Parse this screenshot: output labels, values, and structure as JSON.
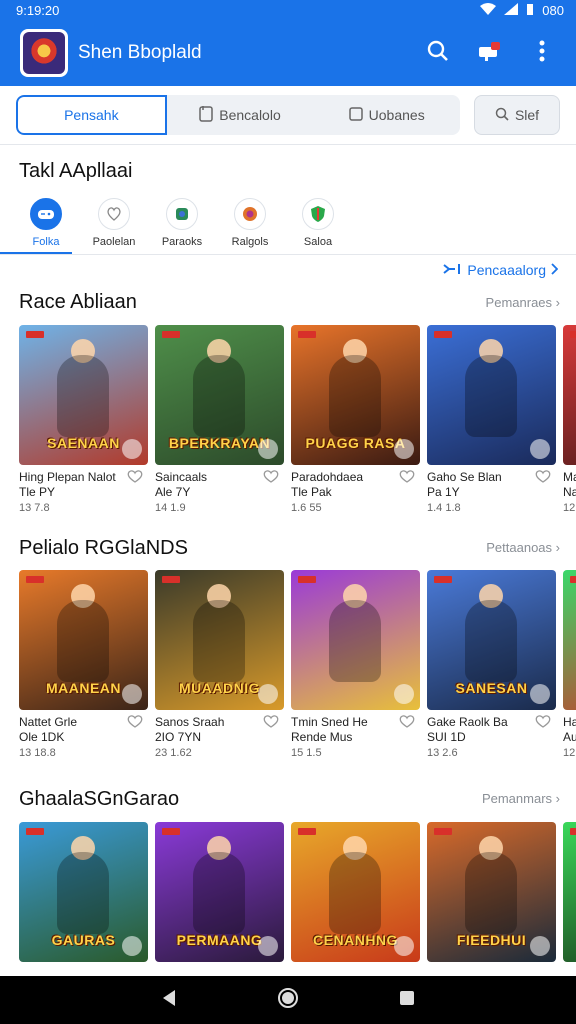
{
  "status_bar": {
    "time": "9:19:20",
    "battery": "080"
  },
  "app_bar": {
    "title": "Shen Bboplald"
  },
  "search_tabs": [
    {
      "label": "Pensahk",
      "icon": "none"
    },
    {
      "label": "Bencalolo",
      "icon": "doc-icon"
    },
    {
      "label": "Uobanes",
      "icon": "box-icon"
    }
  ],
  "filter": {
    "label": "Slef"
  },
  "categories_title": "Takl AApllaai",
  "categories": [
    {
      "label": "Folka",
      "icon": "game-controller-icon",
      "color": "#1a73e8"
    },
    {
      "label": "Paolelan",
      "icon": "heart-hands-icon",
      "color": "#9a9a9a"
    },
    {
      "label": "Paraoks",
      "icon": "puzzle-icon",
      "color": "#2a8a5a"
    },
    {
      "label": "Ralgols",
      "icon": "star-badge-icon",
      "color": "#e0732a"
    },
    {
      "label": "Saloa",
      "icon": "shield-icon",
      "color": "#2aa84a"
    }
  ],
  "recommend_link": "Pencaaalorg",
  "sections": [
    {
      "title": "Race Abliaan",
      "more": "Pemanraes",
      "cards": [
        {
          "l1": "Hing Plepan Nalot",
          "l2": "Tle PY",
          "l3": "13  7.8",
          "art_text": "SAENAAN",
          "c1": "#6fb3e8",
          "c2": "#b23a2a"
        },
        {
          "l1": "Saincaals",
          "l2": "Ale 7Y",
          "l3": "14  1.9",
          "art_text": "BPERKRAYAN",
          "c1": "#4f8f4a",
          "c2": "#2c4a2a"
        },
        {
          "l1": "Paradohdaea",
          "l2": "Tle Pak",
          "l3": "1.6  55",
          "art_text": "PUAGG RASA",
          "c1": "#e8742a",
          "c2": "#3a1a12"
        },
        {
          "l1": "Gaho Se Blan",
          "l2": "Pa 1Y",
          "l3": "1.4  1.8",
          "art_text": "",
          "c1": "#3b6fd6",
          "c2": "#1a2a5a"
        },
        {
          "l1": "Man",
          "l2": "Na",
          "l3": "12",
          "art_text": "",
          "c1": "#d83a3a",
          "c2": "#4a1a1a"
        }
      ]
    },
    {
      "title": "Pelialo RGGlaNDS",
      "more": "Pettaanoas",
      "cards": [
        {
          "l1": "Nattet Grle",
          "l2": "Ole 1DK",
          "l3": "13  18.8",
          "art_text": "MAANEAN",
          "c1": "#e87a2a",
          "c2": "#3a2418"
        },
        {
          "l1": "Sanos Sraah",
          "l2": "2IO 7YN",
          "l3": "23  1.62",
          "art_text": "MUAADNIG",
          "c1": "#3a3a2a",
          "c2": "#d89a2a"
        },
        {
          "l1": "Tmin Sned He",
          "l2": "Rende Mus",
          "l3": "15  1.5",
          "art_text": "",
          "c1": "#9a3ad8",
          "c2": "#e8c03a"
        },
        {
          "l1": "Gake Raolk Ba",
          "l2": "SUI 1D",
          "l3": "13  2.6",
          "art_text": "SANESAN",
          "c1": "#4a7ad8",
          "c2": "#1a2a4a"
        },
        {
          "l1": "Han",
          "l2": "Aut",
          "l3": "12",
          "art_text": "",
          "c1": "#3ad86a",
          "c2": "#c83a2a"
        }
      ]
    },
    {
      "title": "GhaalaSGnGarao",
      "more": "Pemanmars",
      "cards": [
        {
          "l1": "",
          "l2": "",
          "l3": "",
          "art_text": "GAURAS",
          "c1": "#3a9ad8",
          "c2": "#2a5a2a"
        },
        {
          "l1": "",
          "l2": "",
          "l3": "",
          "art_text": "PERMAANG",
          "c1": "#8a3ad8",
          "c2": "#2a1a3a"
        },
        {
          "l1": "",
          "l2": "",
          "l3": "",
          "art_text": "CENANHNG",
          "c1": "#e8a82a",
          "c2": "#c83a1a"
        },
        {
          "l1": "",
          "l2": "",
          "l3": "",
          "art_text": "FIEEDHUI",
          "c1": "#d86a2a",
          "c2": "#1a2a3a"
        },
        {
          "l1": "",
          "l2": "",
          "l3": "",
          "art_text": "",
          "c1": "#3ad85a",
          "c2": "#1a3a1a"
        }
      ]
    }
  ]
}
